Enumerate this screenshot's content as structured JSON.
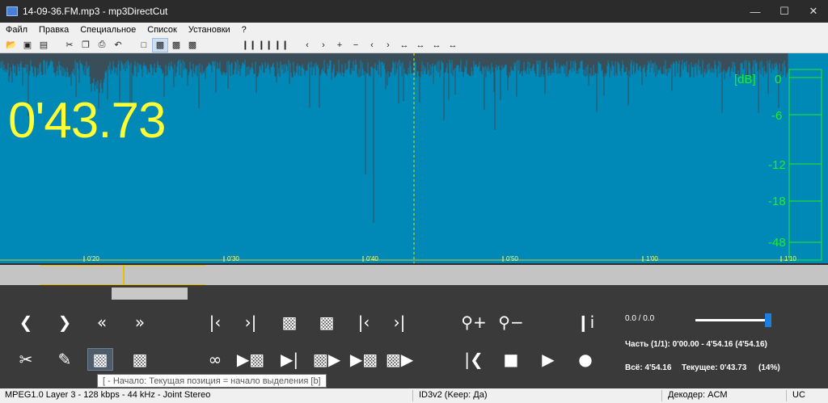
{
  "window": {
    "title": "14-09-36.FM.mp3 - mp3DirectCut"
  },
  "menu": {
    "items": [
      "Файл",
      "Правка",
      "Специальное",
      "Список",
      "Установки",
      "?"
    ]
  },
  "waveform": {
    "timecode": "0'43.73",
    "db_unit": "[dB]",
    "db_scale": [
      "0",
      "-6",
      "-12",
      "-18",
      "-48"
    ],
    "time_ticks": [
      "0'20",
      "0'30",
      "0'40",
      "0'50",
      "1'00",
      "1'10"
    ],
    "wave_color": "#3a4e5a",
    "background_color": "#0088b6",
    "timecode_color": "#ffff33",
    "meter_color": "#22ee22"
  },
  "info": {
    "selection_level": "0.0 / 0.0",
    "part": "Часть (1/1): 0'00.00 - 4'54.16 (4'54.16)",
    "total_label": "Всё: 4'54.16",
    "current_label": "Текущее: 0'43.73",
    "current_percent": "(14%)"
  },
  "tooltip": {
    "text": "[ - Начало: Текущая позиция = начало выделения   [b]"
  },
  "status": {
    "format": "MPEG1.0 Layer 3 - 128 kbps - 44 kHz - Joint Stereo",
    "tag": "ID3v2 (Keep: Да)",
    "decoder": "Декодер: ACM",
    "mode": "UC"
  }
}
